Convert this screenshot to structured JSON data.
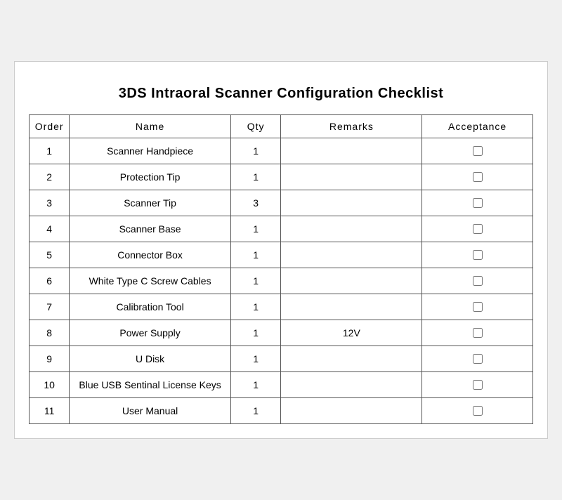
{
  "title": "3DS Intraoral Scanner Configuration Checklist",
  "headers": {
    "order": "Order",
    "name": "Name",
    "qty": "Qty",
    "remarks": "Remarks",
    "acceptance": "Acceptance"
  },
  "rows": [
    {
      "order": "1",
      "name": "Scanner Handpiece",
      "qty": "1",
      "remarks": ""
    },
    {
      "order": "2",
      "name": "Protection Tip",
      "qty": "1",
      "remarks": ""
    },
    {
      "order": "3",
      "name": "Scanner Tip",
      "qty": "3",
      "remarks": ""
    },
    {
      "order": "4",
      "name": "Scanner Base",
      "qty": "1",
      "remarks": ""
    },
    {
      "order": "5",
      "name": "Connector Box",
      "qty": "1",
      "remarks": ""
    },
    {
      "order": "6",
      "name": "White Type C Screw Cables",
      "qty": "1",
      "remarks": ""
    },
    {
      "order": "7",
      "name": "Calibration Tool",
      "qty": "1",
      "remarks": ""
    },
    {
      "order": "8",
      "name": "Power Supply",
      "qty": "1",
      "remarks": "12V"
    },
    {
      "order": "9",
      "name": "U Disk",
      "qty": "1",
      "remarks": ""
    },
    {
      "order": "10",
      "name": "Blue USB Sentinal License Keys",
      "qty": "1",
      "remarks": ""
    },
    {
      "order": "11",
      "name": "User Manual",
      "qty": "1",
      "remarks": ""
    }
  ]
}
